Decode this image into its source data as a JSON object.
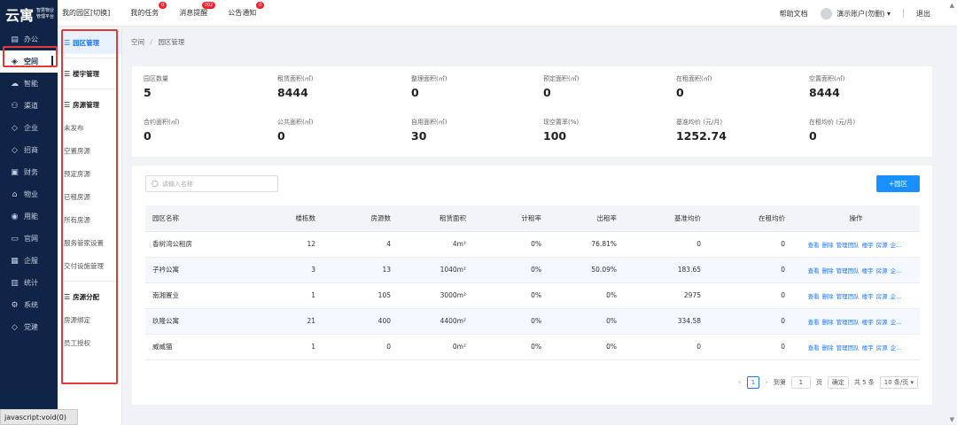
{
  "logo": {
    "mark": "云寓",
    "line1": "智慧物业",
    "line2": "管理平台"
  },
  "rail": [
    {
      "label": "办公",
      "icon": "▤",
      "name": "rail-item-office"
    },
    {
      "label": "空间",
      "icon": "◈",
      "name": "rail-item-space"
    },
    {
      "label": "智能",
      "icon": "☁",
      "name": "rail-item-smart"
    },
    {
      "label": "渠道",
      "icon": "⚇",
      "name": "rail-item-channel"
    },
    {
      "label": "企业",
      "icon": "◇",
      "name": "rail-item-enterprise"
    },
    {
      "label": "招商",
      "icon": "◇",
      "name": "rail-item-investment"
    },
    {
      "label": "财务",
      "icon": "▣",
      "name": "rail-item-finance"
    },
    {
      "label": "物业",
      "icon": "⌂",
      "name": "rail-item-property"
    },
    {
      "label": "用能",
      "icon": "◉",
      "name": "rail-item-energy"
    },
    {
      "label": "官网",
      "icon": "▭",
      "name": "rail-item-website"
    },
    {
      "label": "企服",
      "icon": "▦",
      "name": "rail-item-service"
    },
    {
      "label": "统计",
      "icon": "▥",
      "name": "rail-item-stats"
    },
    {
      "label": "系统",
      "icon": "⚙",
      "name": "rail-item-system"
    },
    {
      "label": "党建",
      "icon": "◇",
      "name": "rail-item-party"
    }
  ],
  "side": {
    "park": "园区管理",
    "building": "楼宇管理",
    "room_group": "房源管理",
    "room_items": [
      "未发布",
      "空置房源",
      "预定房源",
      "已租房源",
      "所有房源",
      "服务管家设置",
      "交付设施管理"
    ],
    "alloc_group": "房源分配",
    "alloc_items": [
      "房源绑定",
      "员工授权"
    ]
  },
  "top": {
    "tabs": [
      {
        "label": "我的园区[切换]",
        "badge": ""
      },
      {
        "label": "我的任务",
        "badge": "0"
      },
      {
        "label": "消息提醒",
        "badge": "202"
      },
      {
        "label": "公告通知",
        "badge": "0"
      }
    ],
    "help": "帮助文档",
    "account": "演示账户(勿删)",
    "logout": "退出"
  },
  "breadcrumb": {
    "root": "空间",
    "current": "园区管理"
  },
  "stats": [
    {
      "label": "园区数量",
      "value": "5"
    },
    {
      "label": "租赁面积(㎡)",
      "value": "8444"
    },
    {
      "label": "整理面积(㎡)",
      "value": "0"
    },
    {
      "label": "预定面积(㎡)",
      "value": "0"
    },
    {
      "label": "在租面积(㎡)",
      "value": "0"
    },
    {
      "label": "空置面积(㎡)",
      "value": "8444"
    },
    {
      "label": "合约面积(㎡)",
      "value": "0"
    },
    {
      "label": "公共面积(㎡)",
      "value": "0"
    },
    {
      "label": "自用面积(㎡)",
      "value": "30"
    },
    {
      "label": "现空置率(%)",
      "value": "100"
    },
    {
      "label": "基准均价 (元/月)",
      "value": "1252.74"
    },
    {
      "label": "在租均价 (元/月)",
      "value": "0"
    }
  ],
  "search": {
    "placeholder": "请输入名称"
  },
  "add_button": "+园区",
  "table": {
    "headers": [
      "园区名称",
      "楼栋数",
      "房源数",
      "租赁面积",
      "计租率",
      "出租率",
      "基准均价",
      "在租均价",
      "操作"
    ],
    "rows": [
      [
        "香树湾公租房",
        "12",
        "4",
        "4m²",
        "0%",
        "76.81%",
        "0",
        "0"
      ],
      [
        "子衿公寓",
        "3",
        "13",
        "1040m²",
        "0%",
        "50.09%",
        "183.65",
        "0"
      ],
      [
        "南湘置业",
        "1",
        "105",
        "3000m²",
        "0%",
        "0%",
        "2975",
        "0"
      ],
      [
        "玖隆公寓",
        "21",
        "400",
        "4400m²",
        "0%",
        "0%",
        "334.58",
        "0"
      ],
      [
        "威威猫",
        "1",
        "0",
        "0m²",
        "0%",
        "0%",
        "0",
        "0"
      ]
    ],
    "ops": [
      "查看",
      "删除",
      "管理团队",
      "楼宇",
      "房源",
      "企..."
    ]
  },
  "pager": {
    "current": "1",
    "goto_label": "到第",
    "goto_value": "1",
    "page_unit": "页",
    "confirm": "确定",
    "total": "共 5 条",
    "size": "10 条/页"
  },
  "statusbar": "javascript:void(0)"
}
